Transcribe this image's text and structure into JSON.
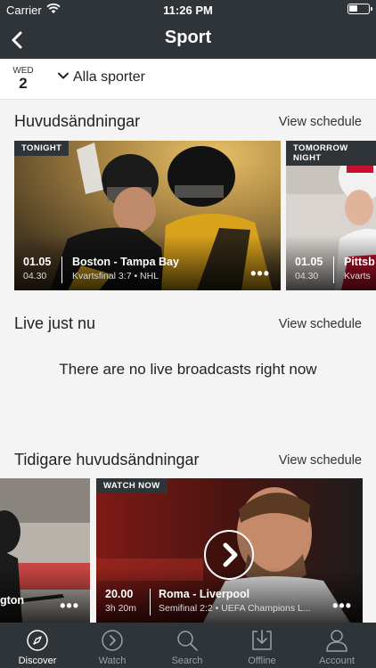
{
  "status": {
    "carrier": "Carrier",
    "time": "11:26 PM"
  },
  "header": {
    "title": "Sport"
  },
  "datebar": {
    "weekday": "WED",
    "day": "2",
    "filter": "Alla sporter"
  },
  "sections": {
    "highlights": {
      "title": "Huvudsändningar",
      "link": "View schedule",
      "cards": [
        {
          "badge": "TONIGHT",
          "date": "01.05",
          "time": "04.30",
          "match": "Boston - Tampa Bay",
          "meta": "Kvartsfinal 3:7 • NHL"
        },
        {
          "badge": "TOMORROW NIGHT",
          "date": "01.05",
          "time": "04.30",
          "match": "Pittsb",
          "meta": "Kvarts"
        }
      ]
    },
    "live": {
      "title": "Live just nu",
      "link": "View schedule",
      "empty": "There are no live broadcasts right now"
    },
    "previous": {
      "title": "Tidigare huvudsändningar",
      "link": "View schedule",
      "cards": [
        {
          "label": "gton"
        },
        {
          "badge": "WATCH NOW",
          "date": "20.00",
          "time": "3h 20m",
          "match": "Roma - Liverpool",
          "meta": "Semifinal 2:2 • UEFA Champions L..."
        }
      ]
    }
  },
  "tabs": [
    {
      "label": "Discover",
      "icon": "compass-icon",
      "active": true
    },
    {
      "label": "Watch",
      "icon": "play-circle-icon",
      "active": false
    },
    {
      "label": "Search",
      "icon": "search-icon",
      "active": false
    },
    {
      "label": "Offline",
      "icon": "download-icon",
      "active": false
    },
    {
      "label": "Account",
      "icon": "person-icon",
      "active": false
    }
  ],
  "colors": {
    "bar": "#2f3438",
    "background": "#f4f4f5",
    "tab_active": "#ffffff",
    "tab_inactive": "#9aa0a5"
  }
}
